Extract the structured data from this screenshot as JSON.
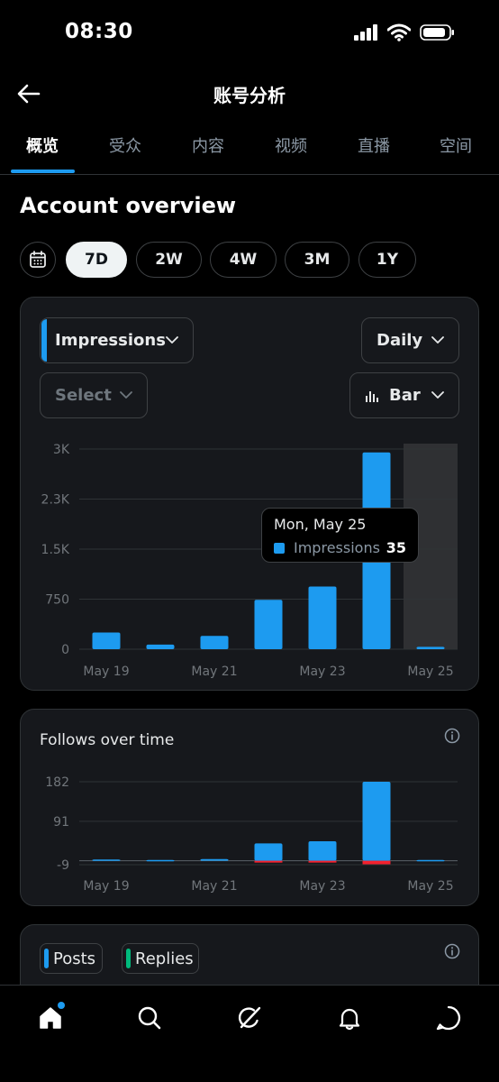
{
  "status": {
    "time": "08:30"
  },
  "header": {
    "title": "账号分析",
    "back_icon": "arrow-left-icon"
  },
  "tabs": [
    {
      "label": "概览",
      "active": true
    },
    {
      "label": "受众"
    },
    {
      "label": "内容"
    },
    {
      "label": "视频"
    },
    {
      "label": "直播"
    },
    {
      "label": "空间"
    }
  ],
  "section": {
    "title": "Account overview"
  },
  "ranges": [
    {
      "label": "7D",
      "active": true
    },
    {
      "label": "2W"
    },
    {
      "label": "4W"
    },
    {
      "label": "3M"
    },
    {
      "label": "1Y"
    }
  ],
  "impressions_card": {
    "metric": "Impressions",
    "interval": "Daily",
    "compare": "Select",
    "chart_type": "Bar",
    "tooltip": {
      "title": "Mon, May 25",
      "label": "Impressions",
      "value": "35"
    }
  },
  "follows_card": {
    "title": "Follows over time"
  },
  "posts_card": {
    "legend": [
      "Posts",
      "Replies"
    ]
  },
  "colors": {
    "accent": "#1d9bf0",
    "negative": "#f4212e",
    "replies": "#00ba7c",
    "highlight": "#2f3033"
  },
  "chart_data": [
    {
      "type": "bar",
      "categories": [
        "May 19",
        "May 20",
        "May 21",
        "May 22",
        "May 23",
        "May 24",
        "May 25"
      ],
      "x_tick_labels": [
        "May 19",
        "May 21",
        "May 23",
        "May 25"
      ],
      "y_tick_labels": [
        "3K",
        "2.3K",
        "1.5K",
        "750",
        "0"
      ],
      "series": [
        {
          "name": "Impressions",
          "values": [
            250,
            70,
            200,
            740,
            940,
            2950,
            35
          ]
        }
      ],
      "ylim": [
        0,
        3000
      ],
      "grid": true,
      "highlighted_category": "May 25"
    },
    {
      "type": "bar",
      "title": "Follows over time",
      "categories": [
        "May 19",
        "May 20",
        "May 21",
        "May 22",
        "May 23",
        "May 24",
        "May 25"
      ],
      "x_tick_labels": [
        "May 19",
        "May 21",
        "May 23",
        "May 25"
      ],
      "y_tick_labels": [
        "182",
        "91",
        "-9"
      ],
      "series": [
        {
          "values": [
            3,
            2,
            4,
            40,
            45,
            182,
            2
          ]
        },
        {
          "values": [
            0,
            0,
            0,
            -2,
            -3,
            -8,
            0
          ]
        }
      ],
      "ylim": [
        -9,
        182
      ],
      "grid": true
    }
  ]
}
